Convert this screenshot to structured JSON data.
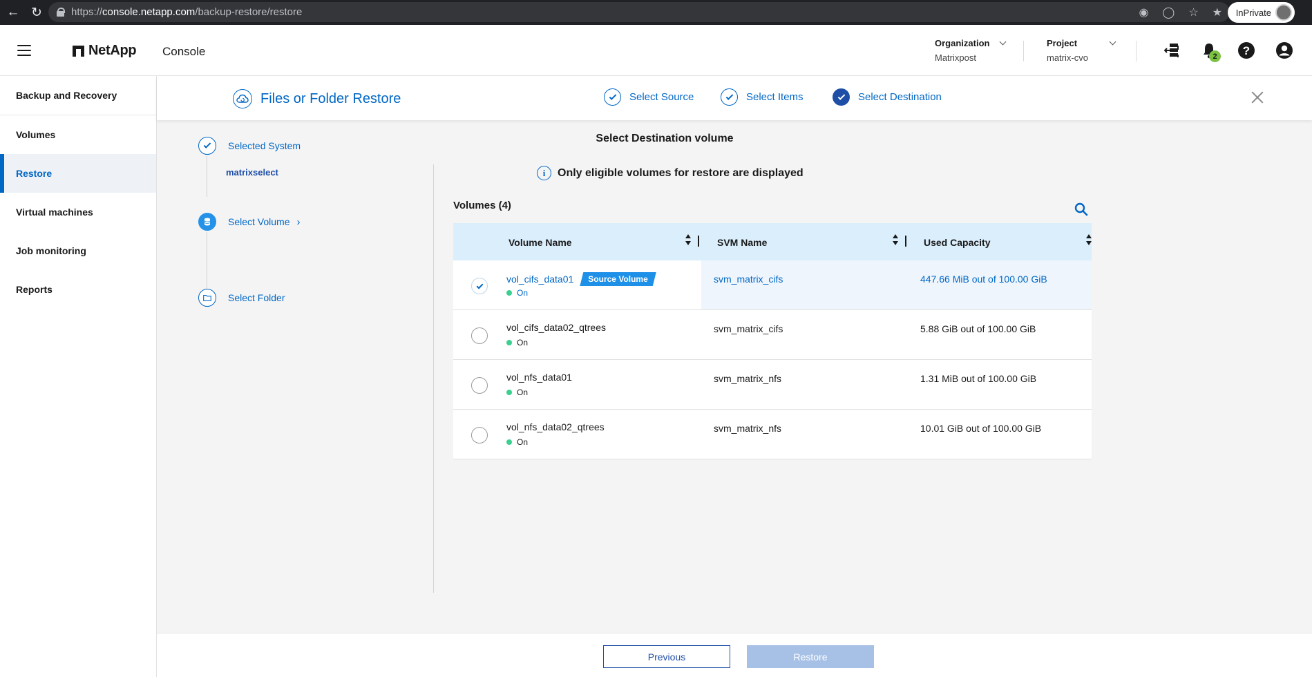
{
  "browser": {
    "url_scheme": "https://",
    "url_host": "console.netapp.com",
    "url_path": "/backup-restore/restore",
    "profile_label": "InPrivate"
  },
  "topnav": {
    "brand": "NetApp",
    "product": "Console",
    "org_label": "Organization",
    "org_value": "Matrixpost",
    "project_label": "Project",
    "project_value": "matrix-cvo",
    "notification_count": "2"
  },
  "sidebar": {
    "header": "Backup and Recovery",
    "items": [
      {
        "label": "Volumes"
      },
      {
        "label": "Restore"
      },
      {
        "label": "Virtual machines"
      },
      {
        "label": "Job monitoring"
      },
      {
        "label": "Reports"
      }
    ]
  },
  "wizard": {
    "title": "Files or Folder Restore",
    "steps": [
      "Select Source",
      "Select Items",
      "Select Destination"
    ]
  },
  "progress": {
    "selected_system_label": "Selected System",
    "selected_system_value": "matrixselect",
    "select_volume_label": "Select Volume",
    "select_folder_label": "Select Folder"
  },
  "content": {
    "section_title": "Select Destination volume",
    "info_text": "Only eligible volumes for restore are displayed",
    "volumes_count_label": "Volumes (4)"
  },
  "table": {
    "columns": [
      "Volume Name",
      "SVM Name",
      "Used Capacity"
    ],
    "source_badge": "Source Volume",
    "rows": [
      {
        "name": "vol_cifs_data01",
        "status": "On",
        "svm": "svm_matrix_cifs",
        "capacity": "447.66 MiB out of 100.00 GiB"
      },
      {
        "name": "vol_cifs_data02_qtrees",
        "status": "On",
        "svm": "svm_matrix_cifs",
        "capacity": "5.88 GiB out of 100.00 GiB"
      },
      {
        "name": "vol_nfs_data01",
        "status": "On",
        "svm": "svm_matrix_nfs",
        "capacity": "1.31 MiB out of 100.00 GiB"
      },
      {
        "name": "vol_nfs_data02_qtrees",
        "status": "On",
        "svm": "svm_matrix_nfs",
        "capacity": "10.01 GiB out of 100.00 GiB"
      }
    ]
  },
  "footer": {
    "previous_label": "Previous",
    "restore_label": "Restore"
  },
  "colors": {
    "accent": "#0067c5",
    "header_row": "#dbeefc",
    "status_on": "#3bcf90",
    "badge": "#1e90e8"
  }
}
